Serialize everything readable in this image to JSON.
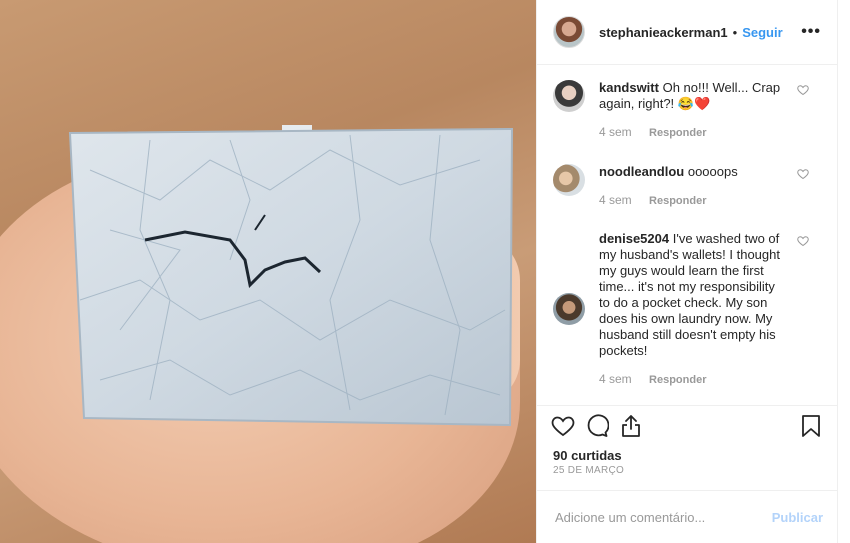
{
  "post": {
    "username": "stephanieackerman1",
    "separator": "•",
    "follow_label": "Seguir",
    "more_label": "•••"
  },
  "comments": [
    {
      "username": "kandswitt",
      "text": "Oh no!!! Well... Crap again, right?! 😂❤️",
      "time": "4 sem",
      "reply_label": "Responder"
    },
    {
      "username": "noodleandlou",
      "text": "ooooops",
      "time": "4 sem",
      "reply_label": "Responder"
    },
    {
      "username": "denise5204",
      "text": "I've washed two of my husband's wallets! I thought my guys would learn the first time... it's not my responsibility to do a pocket check. My son does his own laundry now. My husband still doesn't empty his pockets!",
      "time": "4 sem",
      "reply_label": "Responder"
    }
  ],
  "likes_label": "90 curtidas",
  "date_label": "25 DE MARÇO",
  "add_comment": {
    "placeholder": "Adicione um comentário...",
    "publish_label": "Publicar"
  },
  "icons": [
    "heart-icon",
    "comment-icon",
    "share-icon",
    "bookmark-icon",
    "more-icon"
  ],
  "colors": {
    "link": "#3897f0",
    "publish_disabled": "#b3d3fa",
    "muted": "#999999",
    "text": "#262626"
  }
}
